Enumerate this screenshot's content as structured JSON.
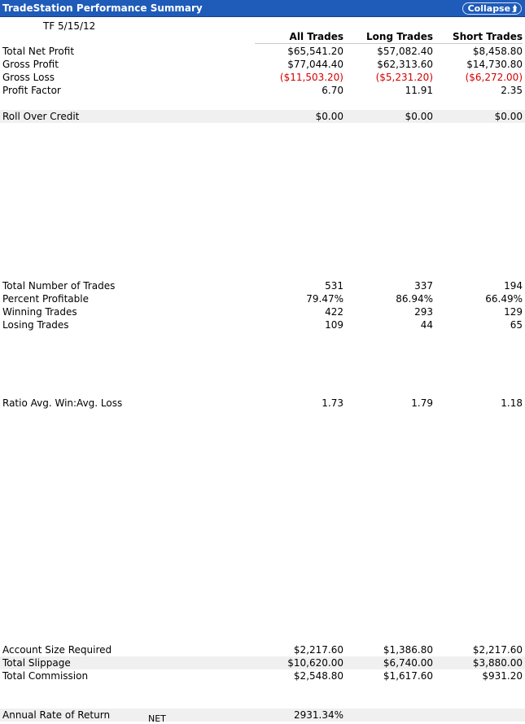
{
  "header": {
    "title": "TradeStation Performance Summary",
    "collapse_label": "Collapse"
  },
  "subtitle": "TF 5/15/12",
  "columns": {
    "all": "All Trades",
    "long": "Long Trades",
    "short": "Short Trades"
  },
  "rows": [
    {
      "label": "Total Net Profit",
      "all": "$65,541.20",
      "long": "$57,082.40",
      "short": "$8,458.80"
    },
    {
      "label": "Gross Profit",
      "all": "$77,044.40",
      "long": "$62,313.60",
      "short": "$14,730.80"
    },
    {
      "label": "Gross Loss",
      "all": "($11,503.20)",
      "long": "($5,231.20)",
      "short": "($6,272.00)"
    },
    {
      "label": "Profit Factor",
      "all": "6.70",
      "long": "11.91",
      "short": "2.35"
    },
    {
      "label": "Roll Over Credit",
      "all": "$0.00",
      "long": "$0.00",
      "short": "$0.00"
    },
    {
      "label": "Total Number of Trades",
      "all": "531",
      "long": "337",
      "short": "194"
    },
    {
      "label": "Percent Profitable",
      "all": "79.47%",
      "long": "86.94%",
      "short": "66.49%"
    },
    {
      "label": "Winning Trades",
      "all": "422",
      "long": "293",
      "short": "129"
    },
    {
      "label": "Losing Trades",
      "all": "109",
      "long": "44",
      "short": "65"
    },
    {
      "label": "Ratio Avg. Win:Avg. Loss",
      "all": "1.73",
      "long": "1.79",
      "short": "1.18"
    },
    {
      "label": "Account Size Required",
      "all": "$2,217.60",
      "long": "$1,386.80",
      "short": "$2,217.60"
    },
    {
      "label": "Total Slippage",
      "all": "$10,620.00",
      "long": "$6,740.00",
      "short": "$3,880.00"
    },
    {
      "label": "Total Commission",
      "all": "$2,548.80",
      "long": "$1,617.60",
      "short": "$931.20"
    },
    {
      "label": "Annual Rate of Return",
      "all": "2931.34%"
    }
  ],
  "net_note": "NET",
  "colors": {
    "header_bg": "#1f5bb8",
    "negative": "#d40000",
    "shaded_row": "#f0f0f0"
  }
}
